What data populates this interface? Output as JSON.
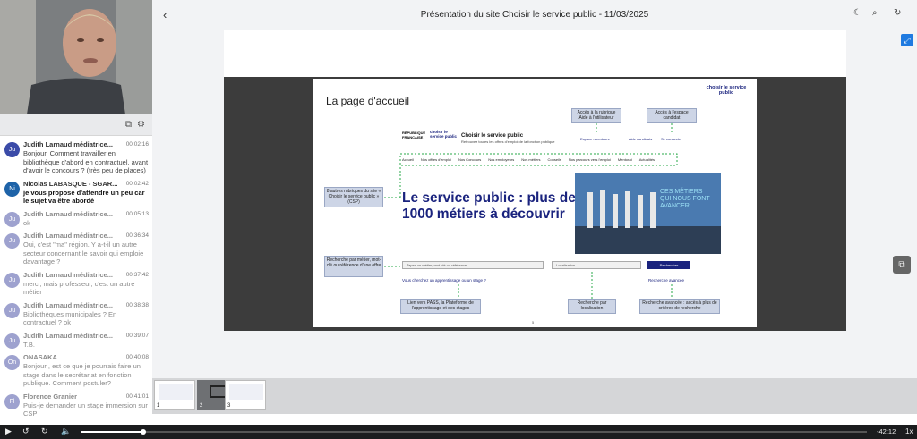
{
  "header": {
    "title": "Présentation du site Choisir le service public - 11/03/2025",
    "back_icon": "chevron-left-icon",
    "icons": [
      "moon-icon",
      "search-icon",
      "refresh-icon"
    ]
  },
  "chat": {
    "messages": [
      {
        "initials": "Ju",
        "author": "Judith Larnaud médiatrice...",
        "time": "00:02:16",
        "text": "Bonjour, Comment travailler en bibliothèque d'abord en contractuel, avant d'avoir le concours ? (très peu de places)",
        "color": "#3b4ba8",
        "style": "normal"
      },
      {
        "initials": "Ni",
        "author": "Nicolas LABASQUE - SGAR...",
        "time": "00:02:42",
        "text": "je vous propose d'attendre un peu car le sujet va être abordé",
        "color": "#1e63a8",
        "style": "bold"
      },
      {
        "initials": "Ju",
        "author": "Judith Larnaud médiatrice...",
        "time": "00:05:13",
        "text": "ok",
        "color": "#9ea2cf",
        "style": "grey"
      },
      {
        "initials": "Ju",
        "author": "Judith Larnaud médiatrice...",
        "time": "00:36:34",
        "text": "Oui, c'est \"ma\" région. Y a-t-il un autre secteur concernant le savoir qui emploie davantage ?",
        "color": "#9ea2cf",
        "style": "grey"
      },
      {
        "initials": "Ju",
        "author": "Judith Larnaud médiatrice...",
        "time": "00:37:42",
        "text": "merci, mais professeur, c'est un autre métier",
        "color": "#9ea2cf",
        "style": "grey"
      },
      {
        "initials": "Ju",
        "author": "Judith Larnaud médiatrice...",
        "time": "00:38:38",
        "text": "Bibliothèques municipales ? En contractuel ? ok",
        "color": "#9ea2cf",
        "style": "grey"
      },
      {
        "initials": "Ju",
        "author": "Judith Larnaud médiatrice...",
        "time": "00:39:07",
        "text": "T.B.",
        "color": "#9ea2cf",
        "style": "grey"
      },
      {
        "initials": "On",
        "author": "ONASAKA",
        "time": "00:40:08",
        "text": "Bonjour , est ce que je pourrais faire un stage dans le secrétariat en fonction publique.  Comment postuler?",
        "color": "#9ea2cf",
        "style": "grey"
      },
      {
        "initials": "Fl",
        "author": "Florence Granier",
        "time": "00:41:01",
        "text": "Puis-je demander un stage immersion sur CSP",
        "color": "#9ea2cf",
        "style": "grey"
      }
    ]
  },
  "slide": {
    "title": "La page d'accueil",
    "logo_text": "choisir le service public",
    "callouts": {
      "aide": "Accès à la rubrique Aide à l'utilisateur",
      "candidat": "Accès à l'espace candidat",
      "rubriques": "8 autres rubriques du site « Choisir le service public » (CSP)",
      "recherche": "Recherche par métier, mot-clé ou référence d'une offre",
      "pass": "Lien vers PASS, la Plateforme de l'apprentissage et des stages",
      "localisation": "Recherche par localisation",
      "avancee": "Recherche avancée : accès à plus de critères de recherche"
    },
    "site": {
      "republique": "RÉPUBLIQUE FRANÇAISE",
      "mini_logo": "choisir le service public",
      "name": "Choisir le service public",
      "subtitle": "Retrouvez toutes les offres d'emploi de la fonction publique",
      "toplinks": [
        "Espace recruteurs",
        "Aide candidats",
        "Se connecter"
      ],
      "nav": [
        "Accueil",
        "Nos offres d'emploi",
        "Nos Concours",
        "Nos employeurs",
        "Nos métiers",
        "Conseils",
        "Nos parcours vers l'emploi",
        "Mentorat",
        "Actualités"
      ],
      "hero": "Le service public : plus de 1000 métiers à découvrir",
      "hero_caption": "CES MÉTIERS QUI NOUS FONT AVANCER",
      "search_placeholder": "Tapez un métier, mot-clé ou référence",
      "location_placeholder": "Localisation",
      "search_button": "Rechercher",
      "apprentissage_link": "Vous cherchez un apprentissage ou un stage ?",
      "advanced_link": "Recherche avancée"
    },
    "page_number": "5"
  },
  "thumbnails": [
    {
      "number": "1",
      "selected": false
    },
    {
      "number": "2",
      "selected": true
    },
    {
      "number": "3",
      "selected": false
    }
  ],
  "player": {
    "remaining": "-42:12",
    "rate": "1x",
    "progress": 0.08
  },
  "colors": {
    "accent": "#1f7ae0",
    "brand_navy": "#1a237e"
  }
}
